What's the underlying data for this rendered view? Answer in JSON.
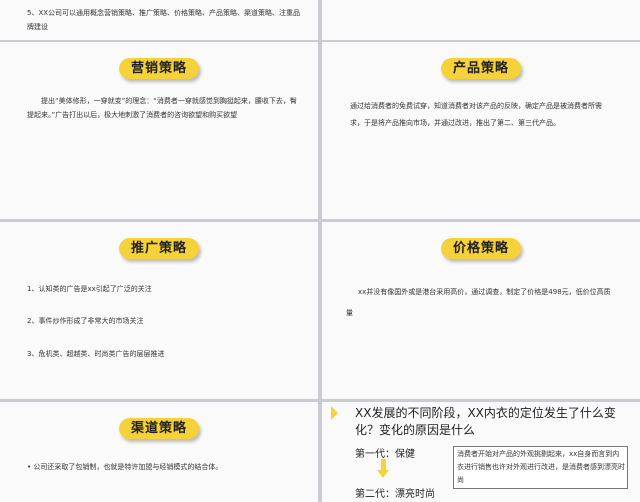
{
  "top": {
    "text": "5、XX公司可以通用概念营销策略、推广策略、价格策略、产品策略、渠道策略、注重品牌建设"
  },
  "marketing": {
    "title": "营销策略",
    "body": "提出“美体修形，一穿就变”的理念：“消费者一穿就感觉到胸挺起来，腰收下去，臀提起来。”广告打出以后，极大地刺激了消费者的咨询欲望和购买欲望"
  },
  "product": {
    "title": "产品策略",
    "body": "通过给消费者的免费试穿，知道消费者对该产品的反映，确定产品是被消费者所需求，于是将产品推向市场，并通过改进，推出了第二、第三代产品。"
  },
  "promotion": {
    "title": "推广策略",
    "items": [
      "1、认知类的广告是xx引起了广泛的关注",
      "2、事件炒作形成了非常大的市场关注",
      "3、危机类、超越类、时尚类广告的层层推进"
    ]
  },
  "price": {
    "title": "价格策略",
    "body": "xx并没有像国外或是港台采用高价，通过调查，制定了价格是498元，低价位高质量"
  },
  "channel": {
    "title": "渠道策略",
    "body": "• 公司还采取了包销制，也就是特许加盟与经销模式的结合体。"
  },
  "question": {
    "title": "XX发展的不同阶段，XX内衣的定位发生了什么变化？变化的原因是什么",
    "gen1": "第一代：保健",
    "gen2": "第二代：漂亮时尚",
    "note": "消费者开始对产品的外观挑剔起来，xx自身而言到内衣进行销售也许对外观进行改进，是消费者感到漂亮时尚"
  },
  "colors": {
    "accent": "#f6d23a",
    "background": "#fafafa",
    "divider": "#c9ccd2"
  }
}
